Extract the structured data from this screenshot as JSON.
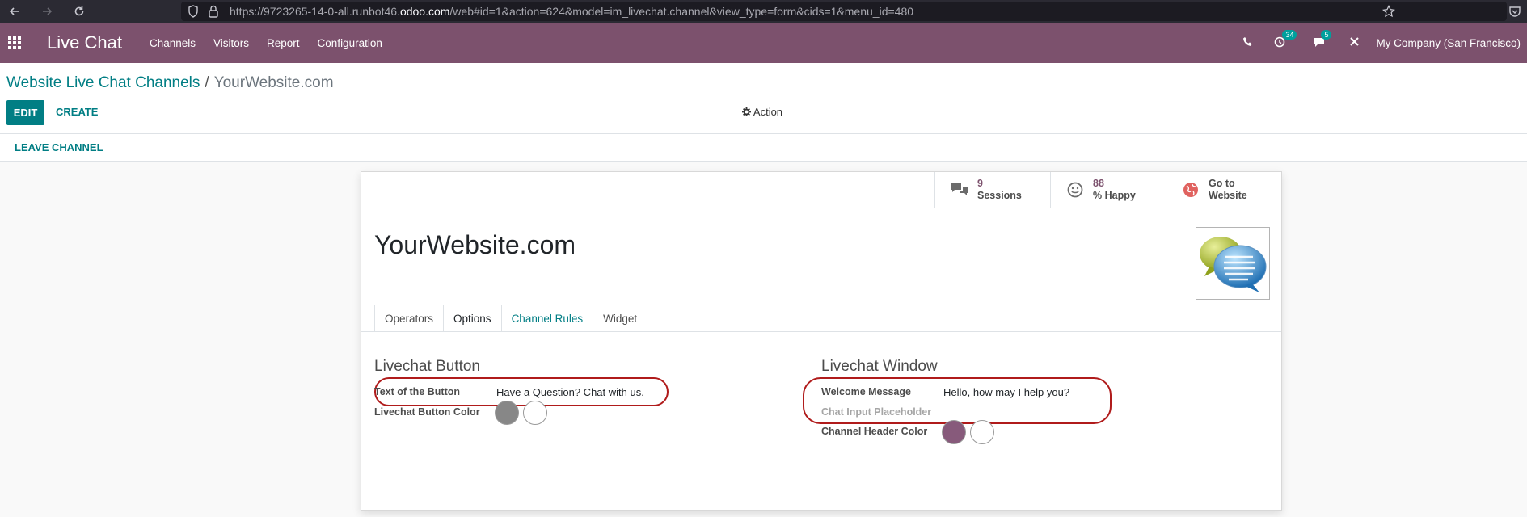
{
  "browser": {
    "url_prefix": "https://9723265-14-0-all.runbot46.",
    "url_domain": "odoo.com",
    "url_suffix": "/web#id=1&action=624&model=im_livechat.channel&view_type=form&cids=1&menu_id=480"
  },
  "nav": {
    "app_title": "Live Chat",
    "menu": [
      "Channels",
      "Visitors",
      "Report",
      "Configuration"
    ],
    "activity_count": "34",
    "message_count": "5",
    "company": "My Company (San Francisco)"
  },
  "control_panel": {
    "breadcrumb_parent": "Website Live Chat Channels",
    "breadcrumb_separator": "/",
    "breadcrumb_current": "YourWebsite.com",
    "edit_label": "EDIT",
    "create_label": "CREATE",
    "action_label": "Action"
  },
  "statusbar": {
    "leave_label": "LEAVE CHANNEL"
  },
  "stat_buttons": {
    "sessions_value": "9",
    "sessions_label": "Sessions",
    "happy_value": "88",
    "happy_label": "% Happy",
    "website_line1": "Go to",
    "website_line2": "Website"
  },
  "record": {
    "title": "YourWebsite.com"
  },
  "tabs": [
    "Operators",
    "Options",
    "Channel Rules",
    "Widget"
  ],
  "livechat_button": {
    "title": "Livechat Button",
    "text_label": "Text of the Button",
    "text_value": "Have a Question? Chat with us.",
    "color_label": "Livechat Button Color"
  },
  "livechat_window": {
    "title": "Livechat Window",
    "welcome_label": "Welcome Message",
    "welcome_value": "Hello, how may I help you?",
    "placeholder_label": "Chat Input Placeholder",
    "header_color_label": "Channel Header Color"
  },
  "colors": {
    "brand": "#7c516d",
    "accent": "#017e84",
    "button_color": "#878787",
    "header_color": "#875a7b",
    "highlight": "#b01b1b"
  }
}
